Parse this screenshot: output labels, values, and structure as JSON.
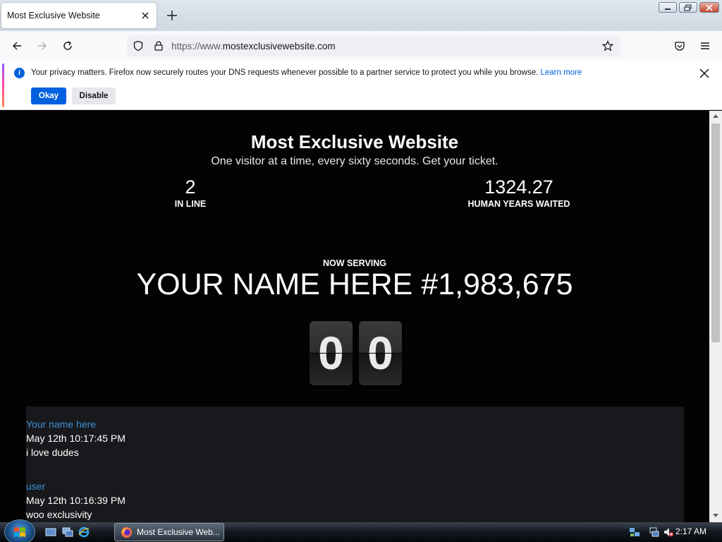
{
  "browser": {
    "tab_title": "Most Exclusive Website",
    "url_prefix": "https://www.",
    "url_host": "mostexclusivewebsite.com"
  },
  "notice": {
    "message": "Your privacy matters. Firefox now securely routes your DNS requests whenever possible to a partner service to protect you while you browse.",
    "link": "Learn more",
    "okay_label": "Okay",
    "disable_label": "Disable"
  },
  "site": {
    "title": "Most Exclusive Website",
    "subtitle": "One visitor at a time, every sixty seconds. Get your ticket.",
    "in_line_count": "2",
    "in_line_label": "IN LINE",
    "years_value": "1324.27",
    "years_label": "HUMAN YEARS WAITED",
    "now_serving_label": "NOW SERVING",
    "now_serving_name": "YOUR NAME HERE #1,983,675",
    "countdown": [
      "0",
      "0"
    ]
  },
  "messages": [
    {
      "user": "Your name here",
      "time": "May 12th 10:17:45 PM",
      "text": "i love dudes"
    },
    {
      "user": "user",
      "time": "May 12th 10:16:39 PM",
      "text": "woo exclusivity"
    }
  ],
  "taskbar": {
    "window_label": "Most Exclusive Web...",
    "clock": "2:17 AM"
  },
  "colors": {
    "accent_link": "#3c8fd6",
    "firefox_blue": "#0061e0",
    "page_bg": "#030303",
    "feed_bg": "#18191c"
  }
}
